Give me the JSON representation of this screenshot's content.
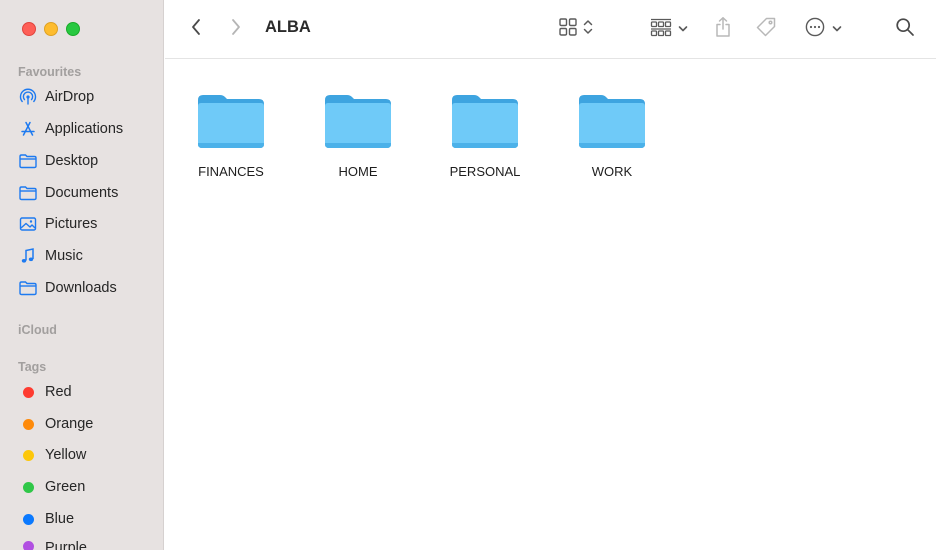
{
  "window": {
    "title": "ALBA"
  },
  "sidebar": {
    "favourites_label": "Favourites",
    "favourites": [
      {
        "label": "AirDrop",
        "icon": "airdrop-icon"
      },
      {
        "label": "Applications",
        "icon": "applications-icon"
      },
      {
        "label": "Desktop",
        "icon": "folder-icon"
      },
      {
        "label": "Documents",
        "icon": "folder-icon"
      },
      {
        "label": "Pictures",
        "icon": "pictures-icon"
      },
      {
        "label": "Music",
        "icon": "music-icon"
      },
      {
        "label": "Downloads",
        "icon": "folder-icon"
      }
    ],
    "icloud_label": "iCloud",
    "tags_label": "Tags",
    "tags": [
      {
        "label": "Red",
        "color": "#fe3b30"
      },
      {
        "label": "Orange",
        "color": "#fe8a0a"
      },
      {
        "label": "Yellow",
        "color": "#fdc70a"
      },
      {
        "label": "Green",
        "color": "#30c748"
      },
      {
        "label": "Blue",
        "color": "#0b79fe"
      },
      {
        "label": "Purple",
        "color": "#b150e1"
      }
    ]
  },
  "toolbar": {
    "back_icon": "chevron-left-icon",
    "forward_icon": "chevron-right-icon",
    "view_icon": "grid-view-icon",
    "group_icon": "group-icon",
    "share_icon": "share-icon",
    "tag_icon": "tag-icon",
    "more_icon": "ellipsis-circle-icon",
    "search_icon": "search-icon"
  },
  "folders": [
    {
      "label": "FINANCES"
    },
    {
      "label": "HOME"
    },
    {
      "label": "PERSONAL"
    },
    {
      "label": "WORK"
    }
  ],
  "colors": {
    "accent": "#1e7af0",
    "folder_blue": "#68c2f4",
    "sidebar_bg": "#e7e2e1"
  }
}
